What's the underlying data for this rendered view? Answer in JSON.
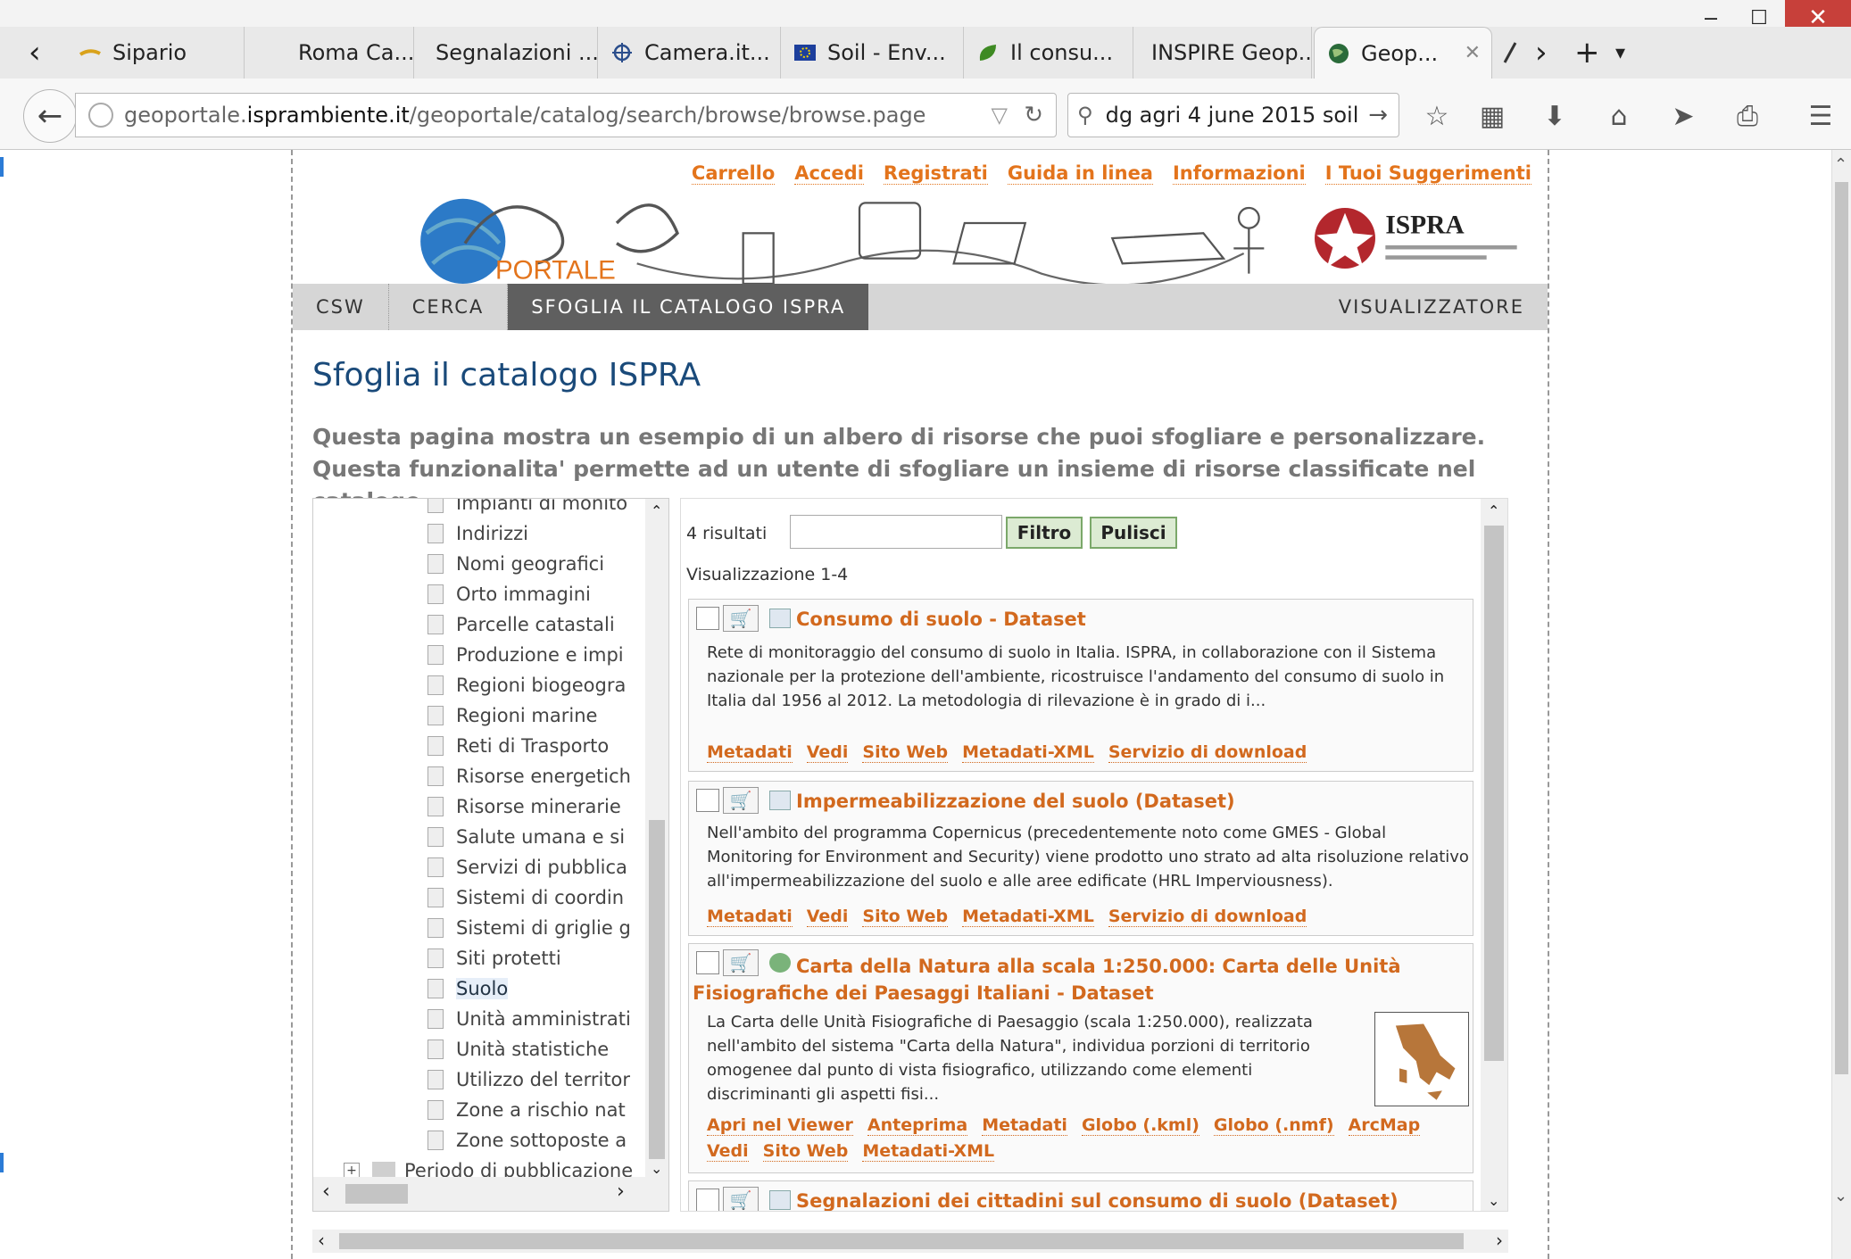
{
  "window": {
    "minimize": "‒",
    "maximize": "☐",
    "close": "✕"
  },
  "tabs": [
    {
      "label": "Sipario",
      "icon": "sipario-favicon"
    },
    {
      "label": "Roma Ca...",
      "icon": "none"
    },
    {
      "label": "Segnalazioni ...",
      "icon": "none"
    },
    {
      "label": "Camera.it...",
      "icon": "camera-favicon"
    },
    {
      "label": "Soil - Env...",
      "icon": "eu-flag-favicon"
    },
    {
      "label": "Il consu...",
      "icon": "leaf-favicon"
    },
    {
      "label": "INSPIRE Geop...",
      "icon": "none"
    },
    {
      "label": "Geop...",
      "icon": "globe-favicon"
    }
  ],
  "tab_controls": {
    "close": "✕",
    "scroll_left": "‹",
    "scroll_right": "›",
    "new_tab": "+",
    "list": "▾"
  },
  "address": {
    "prefix": "geoportale.",
    "domain": "isprambiente.it",
    "path": "/geoportale/catalog/search/browse/browse.page"
  },
  "search": {
    "value": "dg agri 4 june 2015 soil"
  },
  "header": {
    "links": [
      "Carrello",
      "Accedi",
      "Registrati",
      "Guida in linea",
      "Informazioni",
      "I Tuoi Suggerimenti"
    ],
    "logo_text": "PORTALE",
    "ispra": "ISPRA"
  },
  "menu": [
    {
      "label": "CSW",
      "selected": false
    },
    {
      "label": "CERCA",
      "selected": false
    },
    {
      "label": "SFOGLIA IL CATALOGO ISPRA",
      "selected": true
    }
  ],
  "menu_right": "VISUALIZZATORE",
  "page": {
    "title": "Sfoglia il catalogo ISPRA",
    "description": "Questa pagina mostra un esempio di un albero di risorse che puoi sfogliare e personalizzare. Questa funzionalita' permette ad un utente di sfogliare un insieme di risorse classificate nel catalogo"
  },
  "tree": {
    "items": [
      "Impianti di monito",
      "Indirizzi",
      "Nomi geografici",
      "Orto immagini",
      "Parcelle catastali",
      "Produzione e impi",
      "Regioni biogeogra",
      "Regioni marine",
      "Reti di Trasporto",
      "Risorse energetich",
      "Risorse minerarie",
      "Salute umana e si",
      "Servizi di pubblica",
      "Sistemi di coordin",
      "Sistemi di griglie g",
      "Siti protetti",
      "Suolo",
      "Unità amministrati",
      "Unità statistiche",
      "Utilizzo del territor",
      "Zone a rischio nat",
      "Zone sottoposte a"
    ],
    "selected": "Suolo",
    "folder": "Periodo di pubblicazione"
  },
  "results": {
    "count": "4 risultati",
    "filter_button": "Filtro",
    "clear_button": "Pulisci",
    "range": "Visualizzazione 1-4",
    "cards": [
      {
        "title": "Consumo di suolo - Dataset",
        "body": "Rete di monitoraggio del consumo di suolo in Italia. ISPRA, in collaborazione con il Sistema nazionale per la protezione dell'ambiente, ricostruisce l'andamento del consumo di suolo in Italia dal 1956 al 2012. La metodologia di rilevazione è in grado di i...",
        "links": [
          "Metadati",
          "Vedi",
          "Sito Web",
          "Metadati-XML",
          "Servizio di download"
        ]
      },
      {
        "title": "Impermeabilizzazione del suolo (Dataset)",
        "body": "Nell'ambito del programma Copernicus (precedentemente noto come GMES - Global Monitoring for Environment and Security) viene prodotto uno strato ad alta risoluzione relativo all'impermeabilizzazione del suolo e alle aree edificate (HRL Imperviousness).",
        "links": [
          "Metadati",
          "Vedi",
          "Sito Web",
          "Metadati-XML",
          "Servizio di download"
        ]
      },
      {
        "title": "Carta della Natura alla scala 1:250.000: Carta delle Unità Fisiografiche dei Paesaggi Italiani - Dataset",
        "body": "La Carta delle Unità Fisiografiche di Paesaggio (scala 1:250.000), realizzata nell'ambito del sistema \"Carta della Natura\", individua porzioni di territorio omogenee dal punto di vista fisiografico, utilizzando come elementi discriminanti gli aspetti fisi...",
        "links": [
          "Apri nel Viewer",
          "Anteprima",
          "Metadati",
          "Globo (.kml)",
          "Globo (.nmf)",
          "ArcMap",
          "Vedi",
          "Sito Web",
          "Metadati-XML"
        ]
      },
      {
        "title": "Segnalazioni dei cittadini sul consumo di suolo (Dataset)",
        "body": "",
        "links": []
      }
    ]
  }
}
